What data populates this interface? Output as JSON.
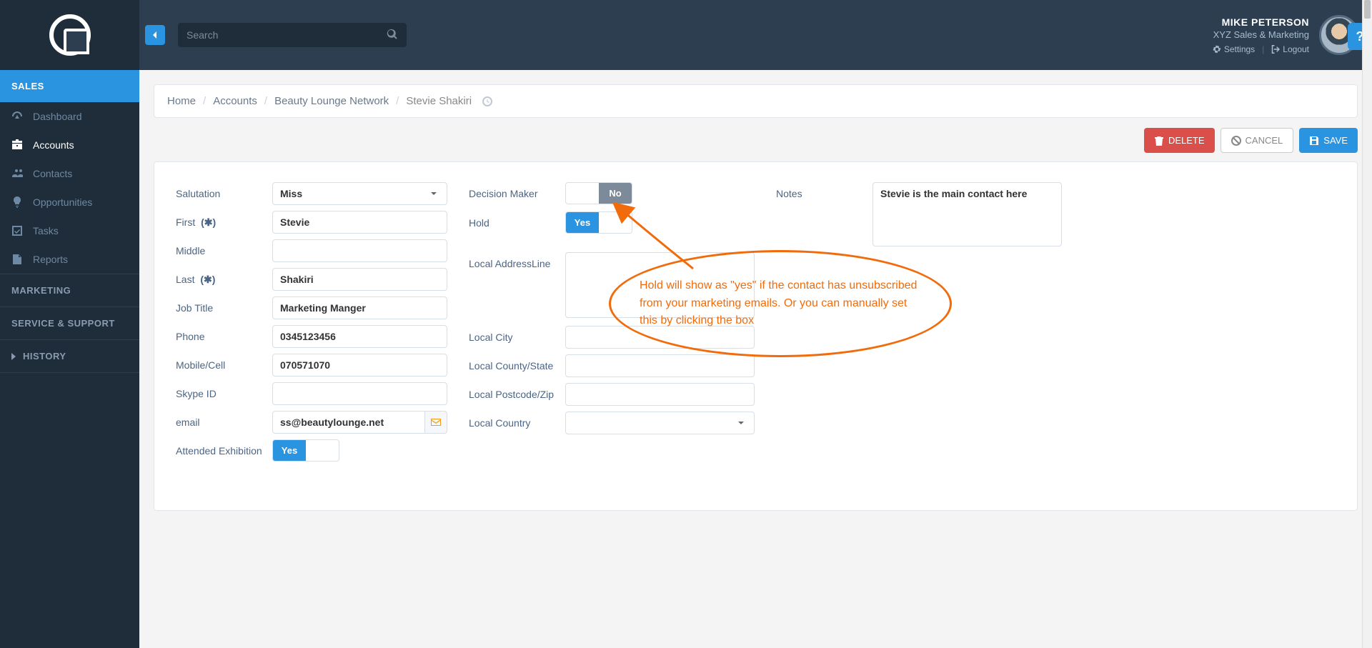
{
  "header": {
    "search_placeholder": "Search",
    "user": {
      "name": "MIKE PETERSON",
      "company": "XYZ Sales & Marketing"
    },
    "links": {
      "settings": "Settings",
      "logout": "Logout"
    },
    "help": "?"
  },
  "sidebar": {
    "sections": {
      "sales": "SALES",
      "marketing": "MARKETING",
      "service": "SERVICE & SUPPORT",
      "history": "HISTORY"
    },
    "items": [
      {
        "label": "Dashboard"
      },
      {
        "label": "Accounts"
      },
      {
        "label": "Contacts"
      },
      {
        "label": "Opportunities"
      },
      {
        "label": "Tasks"
      },
      {
        "label": "Reports"
      }
    ]
  },
  "breadcrumb": {
    "home": "Home",
    "l1": "Accounts",
    "l2": "Beauty Lounge Network",
    "current": "Stevie Shakiri"
  },
  "actions": {
    "delete": "DELETE",
    "cancel": "CANCEL",
    "save": "SAVE"
  },
  "labels": {
    "salutation": "Salutation",
    "first": "First",
    "middle": "Middle",
    "last": "Last",
    "job_title": "Job Title",
    "phone": "Phone",
    "mobile": "Mobile/Cell",
    "skype": "Skype ID",
    "email": "email",
    "attended": "Attended Exhibition",
    "decision": "Decision Maker",
    "hold": "Hold",
    "addr": "Local AddressLine",
    "city": "Local City",
    "county": "Local County/State",
    "postcode": "Local Postcode/Zip",
    "country": "Local Country",
    "notes": "Notes",
    "required": "(✱)"
  },
  "values": {
    "salutation": "Miss",
    "first": "Stevie",
    "middle": "",
    "last": "Shakiri",
    "job_title": "Marketing Manger",
    "phone": "0345123456",
    "mobile": "070571070",
    "skype": "",
    "email": "ss@beautylounge.net",
    "attended": "Yes",
    "decision": "No",
    "hold": "Yes",
    "addr": "",
    "city": "",
    "county": "",
    "postcode": "",
    "country": "",
    "notes": "Stevie is the main contact here"
  },
  "toggle_labels": {
    "yes": "Yes",
    "no": "No"
  },
  "annotation": {
    "text": "Hold will show as \"yes\" if the contact has unsubscribed from your marketing emails. Or you can manually set this by clicking the box"
  }
}
